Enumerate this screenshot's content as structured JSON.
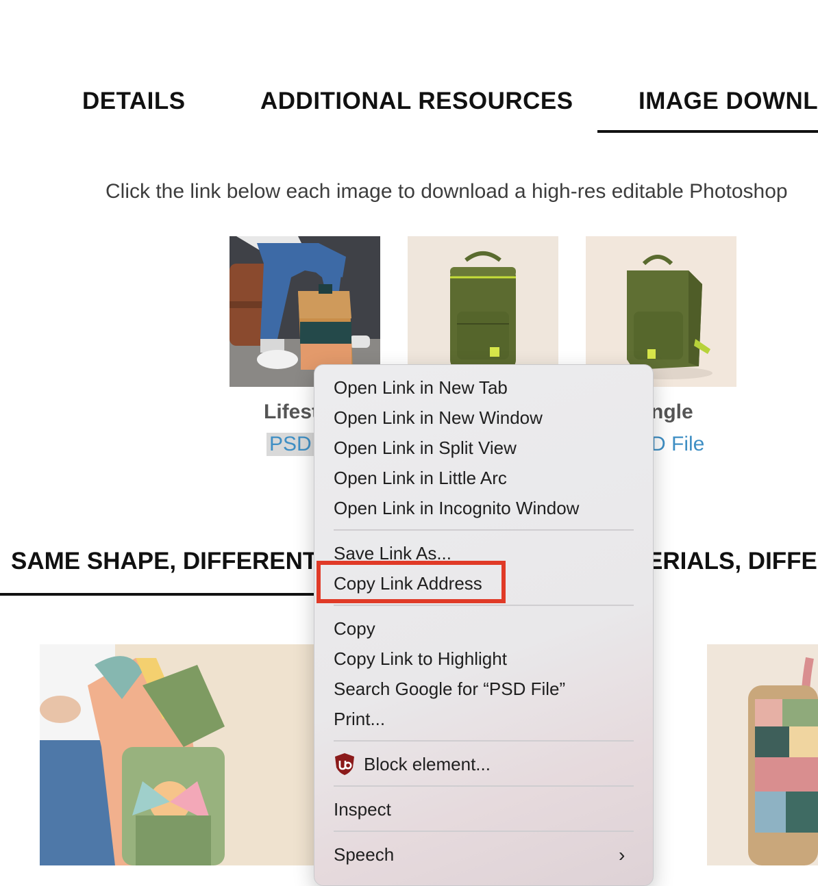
{
  "tabs": [
    {
      "label": "DETAILS"
    },
    {
      "label": "ADDITIONAL RESOURCES"
    },
    {
      "label": "IMAGE DOWNL"
    }
  ],
  "intro_text": "Click the link below each image to download a high-res editable Photoshop",
  "images": [
    {
      "caption": "Lifest",
      "link": "PSD I"
    },
    {
      "caption": "",
      "link": ""
    },
    {
      "caption": "ngle",
      "link": "D File"
    }
  ],
  "sections": [
    {
      "heading": "SAME SHAPE, DIFFERENT I"
    },
    {
      "heading": "ERIALS, DIFFEF"
    }
  ],
  "context_menu": {
    "items": [
      "Open Link in New Tab",
      "Open Link in New Window",
      "Open Link in Split View",
      "Open Link in Little Arc",
      "Open Link in Incognito Window",
      "Save Link As...",
      "Copy Link Address",
      "Copy",
      "Copy Link to Highlight",
      "Search Google for “PSD File”",
      "Print...",
      "Block element...",
      "Inspect",
      "Speech"
    ],
    "highlighted": "Copy Link Address",
    "highlight_color": "#e03a27",
    "extension_icon": "ublock-origin-icon",
    "submenu_icon": "chevron-right-icon"
  }
}
